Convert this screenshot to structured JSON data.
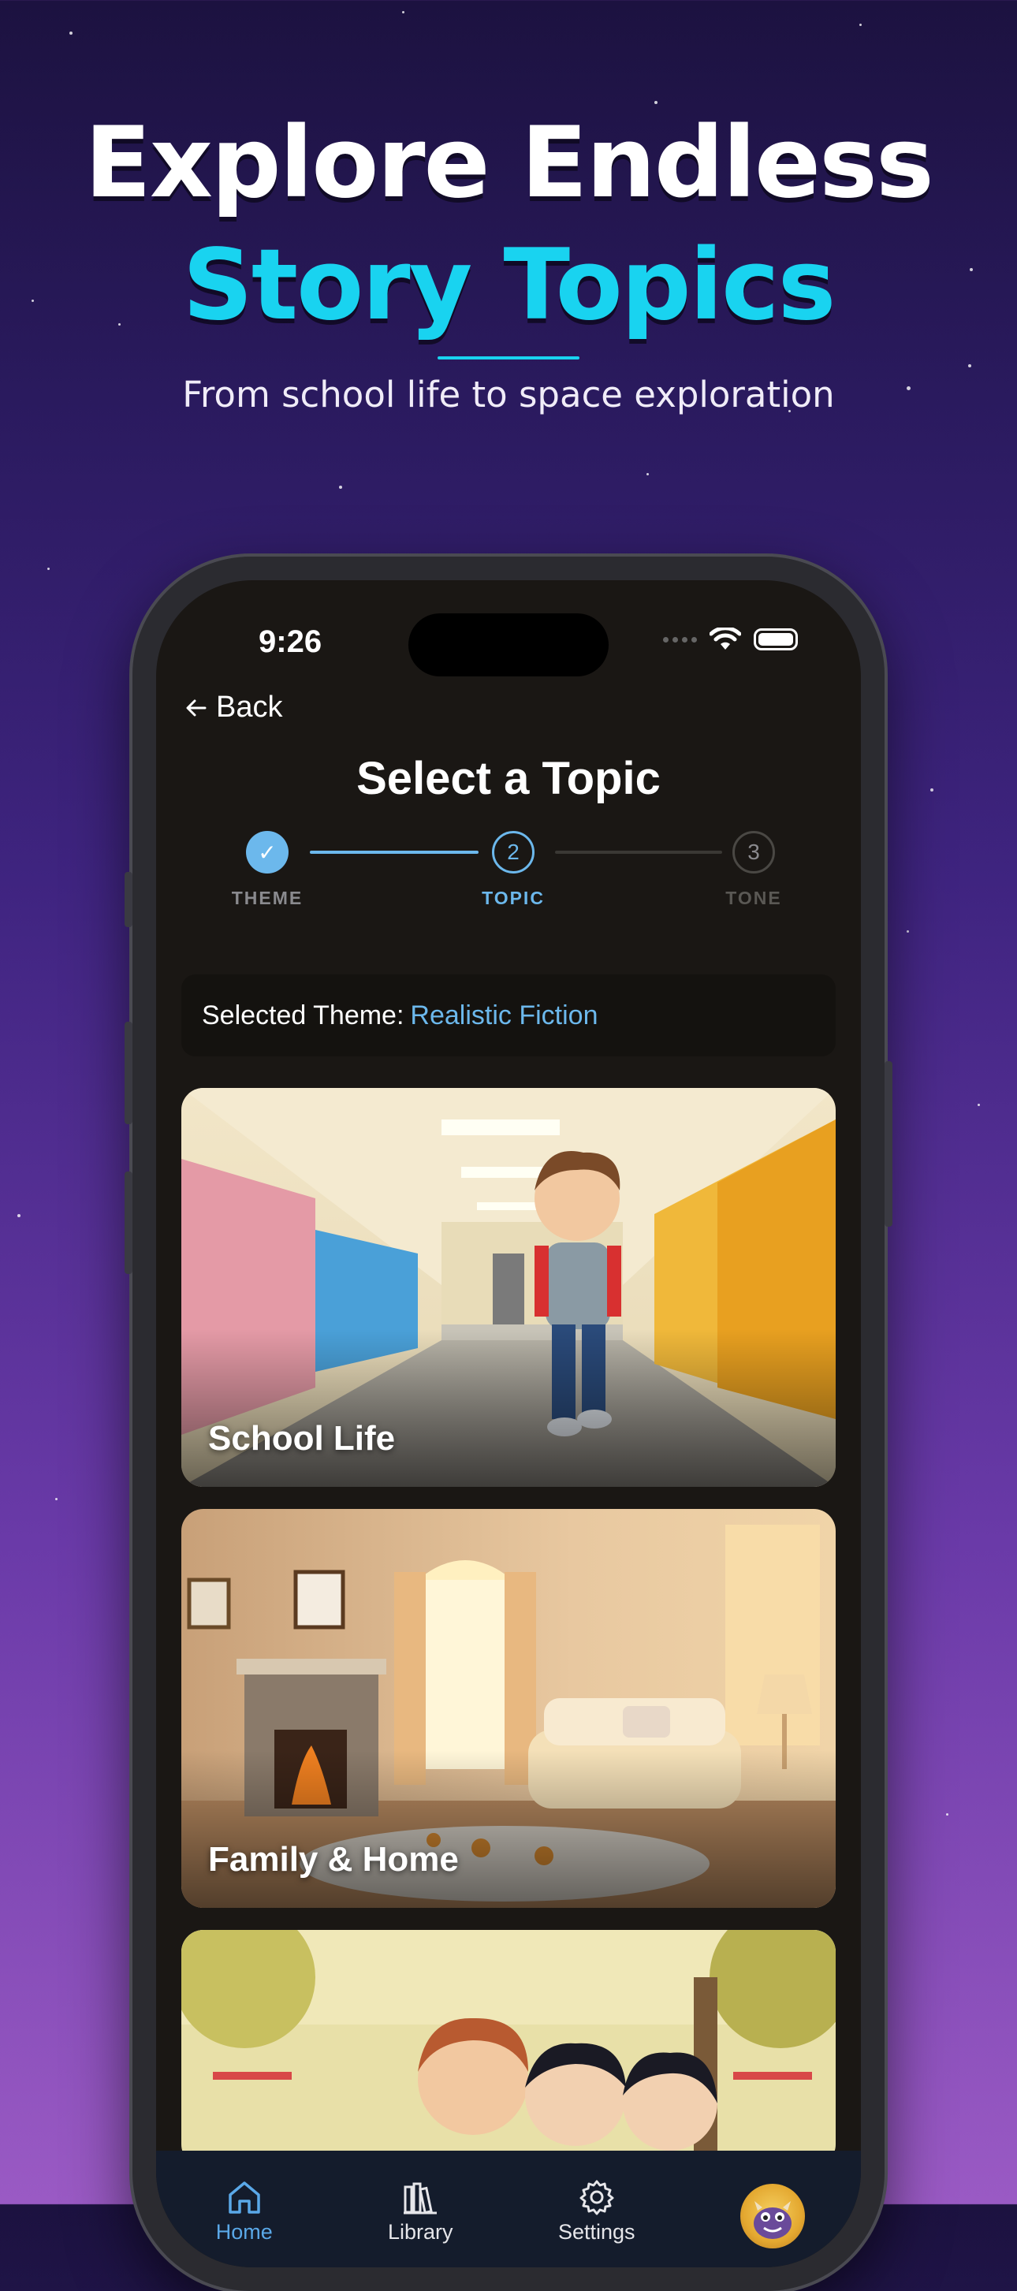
{
  "promo": {
    "headline_line1": "Explore Endless",
    "headline_line2": "Story Topics",
    "subheadline": "From school life to space exploration"
  },
  "status_bar": {
    "time": "9:26"
  },
  "nav": {
    "back_label": "Back"
  },
  "page": {
    "title": "Select a Topic"
  },
  "stepper": {
    "steps": [
      {
        "label": "THEME",
        "state": "completed",
        "marker": "✓"
      },
      {
        "label": "TOPIC",
        "state": "active",
        "marker": "2"
      },
      {
        "label": "TONE",
        "state": "upcoming",
        "marker": "3"
      }
    ]
  },
  "selected_theme": {
    "label": "Selected Theme:",
    "value": "Realistic Fiction"
  },
  "topics": [
    {
      "label": "School Life"
    },
    {
      "label": "Family & Home"
    },
    {
      "label": ""
    }
  ],
  "tab_bar": {
    "items": [
      {
        "label": "Home",
        "icon": "home-icon",
        "active": true
      },
      {
        "label": "Library",
        "icon": "library-icon",
        "active": false
      },
      {
        "label": "Settings",
        "icon": "gear-icon",
        "active": false
      },
      {
        "label": "",
        "icon": "avatar",
        "active": false
      }
    ]
  },
  "colors": {
    "accent": "#5aa8e8",
    "headline_cyan": "#19d3f0",
    "screen_bg": "#1a1714"
  }
}
